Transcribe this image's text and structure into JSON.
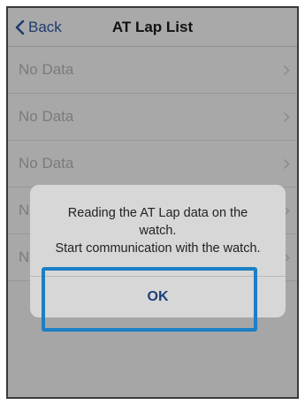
{
  "navbar": {
    "back_label": "Back",
    "title": "AT Lap List"
  },
  "list": {
    "items": [
      {
        "label": "No Data"
      },
      {
        "label": "No Data"
      },
      {
        "label": "No Data"
      },
      {
        "label": "No Data"
      },
      {
        "label": "No Data"
      }
    ],
    "chevron_icon": "chevron-right-icon"
  },
  "dialog": {
    "message": "Reading the AT Lap data on the\nwatch.\nStart communication with the watch.",
    "ok_label": "OK"
  },
  "colors": {
    "accent": "#1d3f7a",
    "highlight": "#1b7fc4"
  }
}
